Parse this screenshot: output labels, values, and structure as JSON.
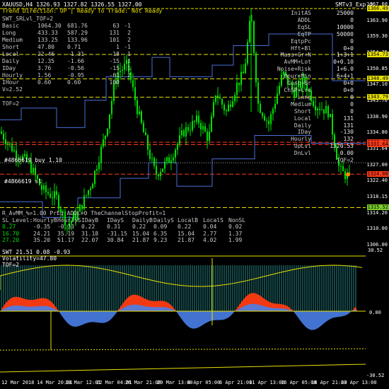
{
  "header": {
    "symbol_line": "XAUUSD,H4  1326.93 1327.82 1326.55 1327.00",
    "right_title": "SMTv3_Exp ☺",
    "status_line": "Trend Direction: UP  |  Ready To Trade: Not Ready"
  },
  "stats": {
    "title": "SWT_SRLvl_TOF=2",
    "rows": [
      [
        "Basic",
        "1064.30",
        "681.76",
        "63",
        "-1"
      ],
      [
        "Long",
        "433.33",
        "587.29",
        "131",
        "2"
      ],
      [
        "Medium",
        "133.25",
        "133.96",
        "101",
        "2"
      ],
      [
        "Short",
        "47.80",
        "0.71",
        "1",
        "-1"
      ],
      [
        "Local",
        "22.46",
        "-1.31",
        "-18",
        "1"
      ],
      [
        "Daily",
        "12.35",
        "-1.66",
        "-15",
        "1"
      ],
      [
        "IDay",
        "3.76",
        "-0.56",
        "-15",
        "1"
      ],
      [
        "Hourly",
        "1.56",
        "-0.95",
        "-61",
        "2"
      ],
      [
        "IHour",
        "0.60",
        "0.60",
        "100",
        ""
      ]
    ],
    "v_line": "V=2.52",
    "tof_line": "TOF=2"
  },
  "info_panel": [
    [
      "InitAS",
      "25000"
    ],
    [
      "ADDL",
      "0"
    ],
    [
      "EqSL",
      "10000"
    ],
    [
      "EqTP",
      "50000"
    ],
    [
      "EqtpPc",
      "0"
    ],
    [
      "Hft+Bl",
      "0+0"
    ],
    [
      "Mass+Gr+N",
      "1+3+1"
    ],
    [
      "AvMM+Lot",
      "0+0.10"
    ],
    [
      "Noise+Risk",
      "1+6.0"
    ],
    [
      "Hour+Min",
      "6+4+1"
    ],
    [
      "Cost+Br",
      "0+0"
    ],
    [
      "ChSP+Lre",
      "0+0"
    ],
    [
      "Long",
      "0"
    ],
    [
      "Medium",
      "0"
    ],
    [
      "Short",
      "0"
    ],
    [
      "Local",
      "131"
    ],
    [
      "Daily",
      "131"
    ],
    [
      "IDay",
      "-130"
    ],
    [
      "Hourly",
      "132"
    ],
    [
      "UpLvl",
      "1320.53"
    ],
    [
      "DnLvl",
      "0.00"
    ]
  ],
  "info_tof": "TOF=2",
  "price_labels": [
    "1367.60",
    "1363.90",
    "1359.30",
    "1354.35",
    "1350.85",
    "1347.10",
    "1343.70",
    "1338.90",
    "1334.80",
    "1331.64",
    "1327.00",
    "1322.40",
    "1318.15",
    "1314.20",
    "1310.00",
    "1306.00"
  ],
  "price_badges": [
    {
      "text": "1366.49",
      "color": "#e8e000"
    },
    {
      "text": "1354.73",
      "color": "#e8e000"
    },
    {
      "text": "1348.49",
      "color": "#e8e000"
    },
    {
      "text": "1343.79",
      "color": "#e8e000"
    },
    {
      "text": "1332.24",
      "color": "#ff3a1a"
    },
    {
      "text": "1331.64",
      "color": "#ff3a1a"
    },
    {
      "text": "1324.08",
      "color": "#ff3a1a"
    },
    {
      "text": "1315.52",
      "color": "#7ccf2a"
    }
  ],
  "order_labels": {
    "buy": "#4866619 buy 1.10",
    "sl": "#4866619 sl"
  },
  "sl_panel": {
    "line1": "R_AvMM_%=1.00  PrEq  ADDL=0   TheChannelStopProfit=1",
    "headers": [
      "SL_Level:",
      "HourlyB",
      "HourlyS",
      "IDayB",
      "IDayS",
      "DailyB",
      "DailyS",
      "LocalB",
      "LocalS",
      "NonSL"
    ],
    "row1": [
      "0.27",
      "-0.35",
      "-0.33",
      "0.22",
      "0.31",
      "0.22",
      "0.09",
      "0.22",
      "0.04",
      "0.02"
    ],
    "row2": [
      "16.70",
      "24.21",
      "35.19",
      "31.18",
      "-31.15",
      "15.04",
      "6.35",
      "15.04",
      "2.77",
      "1.37"
    ],
    "row3": [
      "27.20",
      "35.20",
      "51.17",
      "22.07",
      "30.84",
      "21.87",
      "9.23",
      "21.87",
      "4.02",
      "1.99"
    ]
  },
  "oscillator": {
    "header": "SWT 21.51 0.08 -0.93",
    "label": "Volatility=47.80",
    "tof": "TOF=2",
    "scale": [
      "30.52",
      "0.00",
      "-30.52"
    ]
  },
  "dates": [
    "12 Mar 2018",
    "14 Mar 20:01",
    "19 Mar 12:01",
    "22 Mar 04:01",
    "26 Mar 21:00",
    "29 Mar 13:00",
    "4 Apr 05:00",
    "6 Apr 21:00",
    "11 Apr 13:00",
    "16 Apr 05:00",
    "18 Apr 21:00",
    "23 Apr 13:00"
  ],
  "colors": {
    "background": "#000000",
    "candle": "#00e000",
    "level_yellow": "#e8e000",
    "level_red": "#ff3a1a",
    "channel_blue": "#4a6fd8",
    "osc_red": "#ff3a10",
    "osc_blue": "#4a80e8"
  }
}
